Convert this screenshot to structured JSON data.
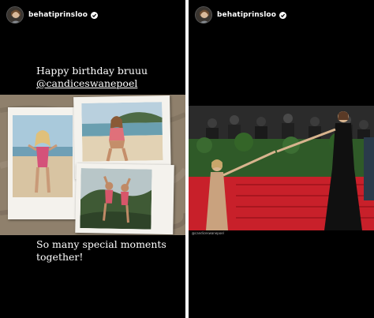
{
  "stories": [
    {
      "username": "behatiprinsloo",
      "caption_line1": "Happy birthday bruuu",
      "caption_mention": "@candiceswanepoel",
      "caption_bottom_line1": "So many special moments",
      "caption_bottom_line2": "together!"
    },
    {
      "username": "behatiprinsloo",
      "photo_credit": "@candiceswanepoel"
    }
  ],
  "colors": {
    "background": "#000000",
    "divider": "#ffffff",
    "text": "#ffffff",
    "red_carpet": "#c8202a"
  }
}
